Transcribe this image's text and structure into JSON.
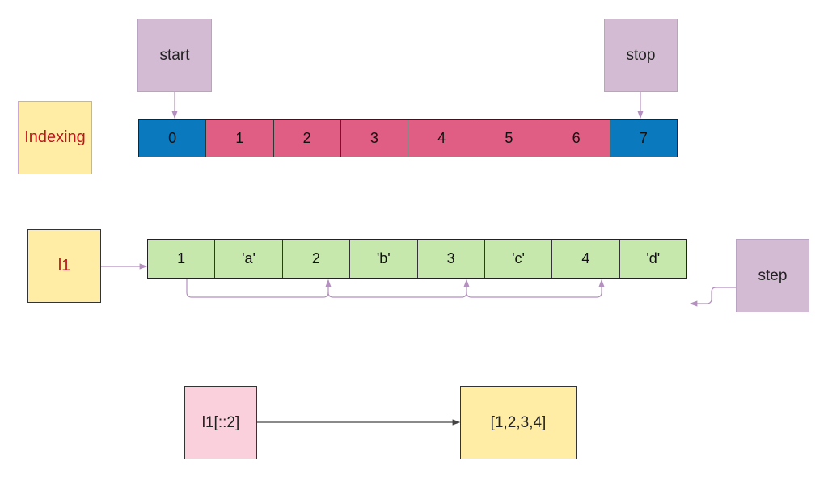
{
  "labels": {
    "start": "start",
    "stop": "stop",
    "indexing": "Indexing",
    "list_name": "l1",
    "step": "step",
    "expression": "l1[::2]",
    "result": "[1,2,3,4]"
  },
  "index_cells": [
    {
      "text": "0",
      "color": "#0b79bd"
    },
    {
      "text": "1",
      "color": "#e05d84"
    },
    {
      "text": "2",
      "color": "#e05d84"
    },
    {
      "text": "3",
      "color": "#e05d84"
    },
    {
      "text": "4",
      "color": "#e05d84"
    },
    {
      "text": "5",
      "color": "#e05d84"
    },
    {
      "text": "6",
      "color": "#e05d84"
    },
    {
      "text": "7",
      "color": "#0b79bd"
    }
  ],
  "list_cells": [
    "1",
    "'a'",
    "2",
    "'b'",
    "3",
    "'c'",
    "4",
    "'d'"
  ],
  "colors": {
    "box_purple": "#d3bcd3",
    "box_yellow": "#ffeda6",
    "box_pink": "#f9d0dc",
    "list_green": "#c7e8ad",
    "indexing_text": "#c0141c",
    "connector": "#b48fc0"
  }
}
